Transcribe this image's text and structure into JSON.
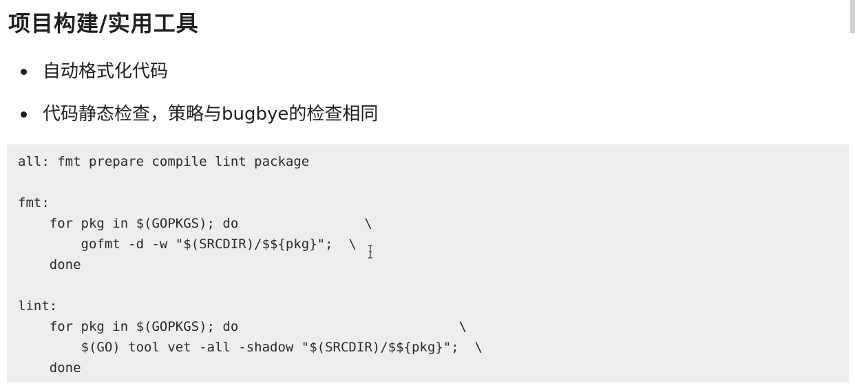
{
  "slide": {
    "title": "项目构建/实用工具",
    "bullets": [
      "自动格式化代码",
      "代码静态检查，策略与bugbye的检查相同"
    ],
    "code_lines": [
      "all: fmt prepare compile lint package",
      "",
      "fmt:",
      "    for pkg in $(GOPKGS); do                \\",
      "        gofmt -d -w \"$(SRCDIR)/$${pkg}\";  \\",
      "    done",
      "",
      "lint:",
      "    for pkg in $(GOPKGS); do                            \\",
      "        $(GO) tool vet -all -shadow \"$(SRCDIR)/$${pkg}\";  \\",
      "    done"
    ]
  },
  "icons": {
    "cursor": "text-cursor-icon"
  },
  "colors": {
    "code_background": "#ededed",
    "text": "#1f1f1f"
  }
}
